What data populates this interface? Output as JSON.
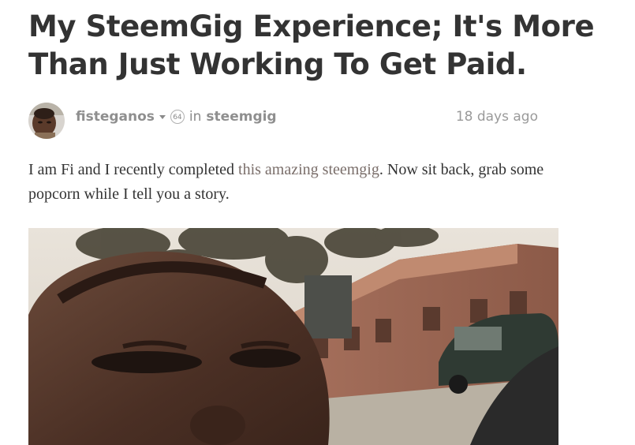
{
  "post": {
    "title": "My SteemGig Experience; It's More Than Just Working To Get Paid.",
    "author": "fisteganos",
    "reputation": "64",
    "in_label": "in",
    "community": "steemgig",
    "timestamp": "18 days ago",
    "body_text_1": "I am Fi and I recently completed ",
    "body_link": "this amazing steemgig",
    "body_text_2": ". Now sit back, grab some popcorn while I tell you a story."
  },
  "icons": {
    "caret": "chevron-down-icon",
    "avatar": "user-avatar",
    "image": "selfie-photo"
  },
  "colors": {
    "title": "#333333",
    "meta": "#8a8a8a",
    "link": "#7a6e6a"
  }
}
